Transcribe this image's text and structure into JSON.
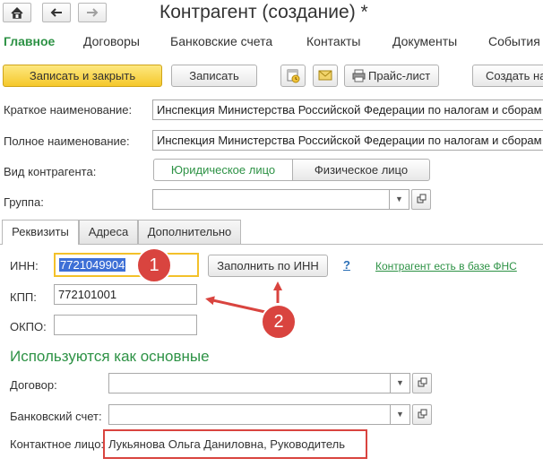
{
  "window": {
    "title": "Контрагент (создание) *",
    "home_icon": "home-icon",
    "back_icon": "arrow-left-icon",
    "forward_icon": "arrow-right-icon"
  },
  "menu": {
    "items": [
      "Главное",
      "Договоры",
      "Банковские счета",
      "Контакты",
      "Документы",
      "События"
    ],
    "active": "Главное"
  },
  "toolbar": {
    "save_close": "Записать и закрыть",
    "save": "Записать",
    "price_list": "Прайс-лист",
    "create_based": "Создать на",
    "schedule_icon": "calendar-clock-icon",
    "mail_icon": "envelope-icon",
    "print_icon": "printer-icon"
  },
  "form": {
    "short_name_label": "Краткое наименование:",
    "short_name_value": "Инспекция Министерства Российской Федерации по налогам и сборам",
    "full_name_label": "Полное наименование:",
    "full_name_value": "Инспекция Министерства Российской Федерации по налогам и сборам",
    "type_label": "Вид контрагента:",
    "type_legal": "Юридическое лицо",
    "type_individual": "Физическое лицо",
    "group_label": "Группа:",
    "group_value": ""
  },
  "tabs": {
    "items": [
      "Реквизиты",
      "Адреса",
      "Дополнительно"
    ],
    "active": "Реквизиты"
  },
  "requisites": {
    "inn_label": "ИНН:",
    "inn_value": "7721049904",
    "fill_button": "Заполнить по ИНН",
    "help_icon": "question-mark-icon",
    "help_text": "?",
    "fns_link": "Контрагент есть в базе ФНС",
    "kpp_label": "КПП:",
    "kpp_value": "772101001",
    "okpo_label": "ОКПО:",
    "okpo_value": ""
  },
  "defaults": {
    "title": "Используются как основные",
    "contract_label": "Договор:",
    "contract_value": "",
    "bank_label": "Банковский счет:",
    "bank_value": "",
    "contact_label": "Контактное лицо:",
    "contact_value": "Лукьянова Ольга Даниловна, Руководитель"
  },
  "annotations": {
    "marker1": "1",
    "marker2": "2",
    "accent": "#d9443f"
  }
}
